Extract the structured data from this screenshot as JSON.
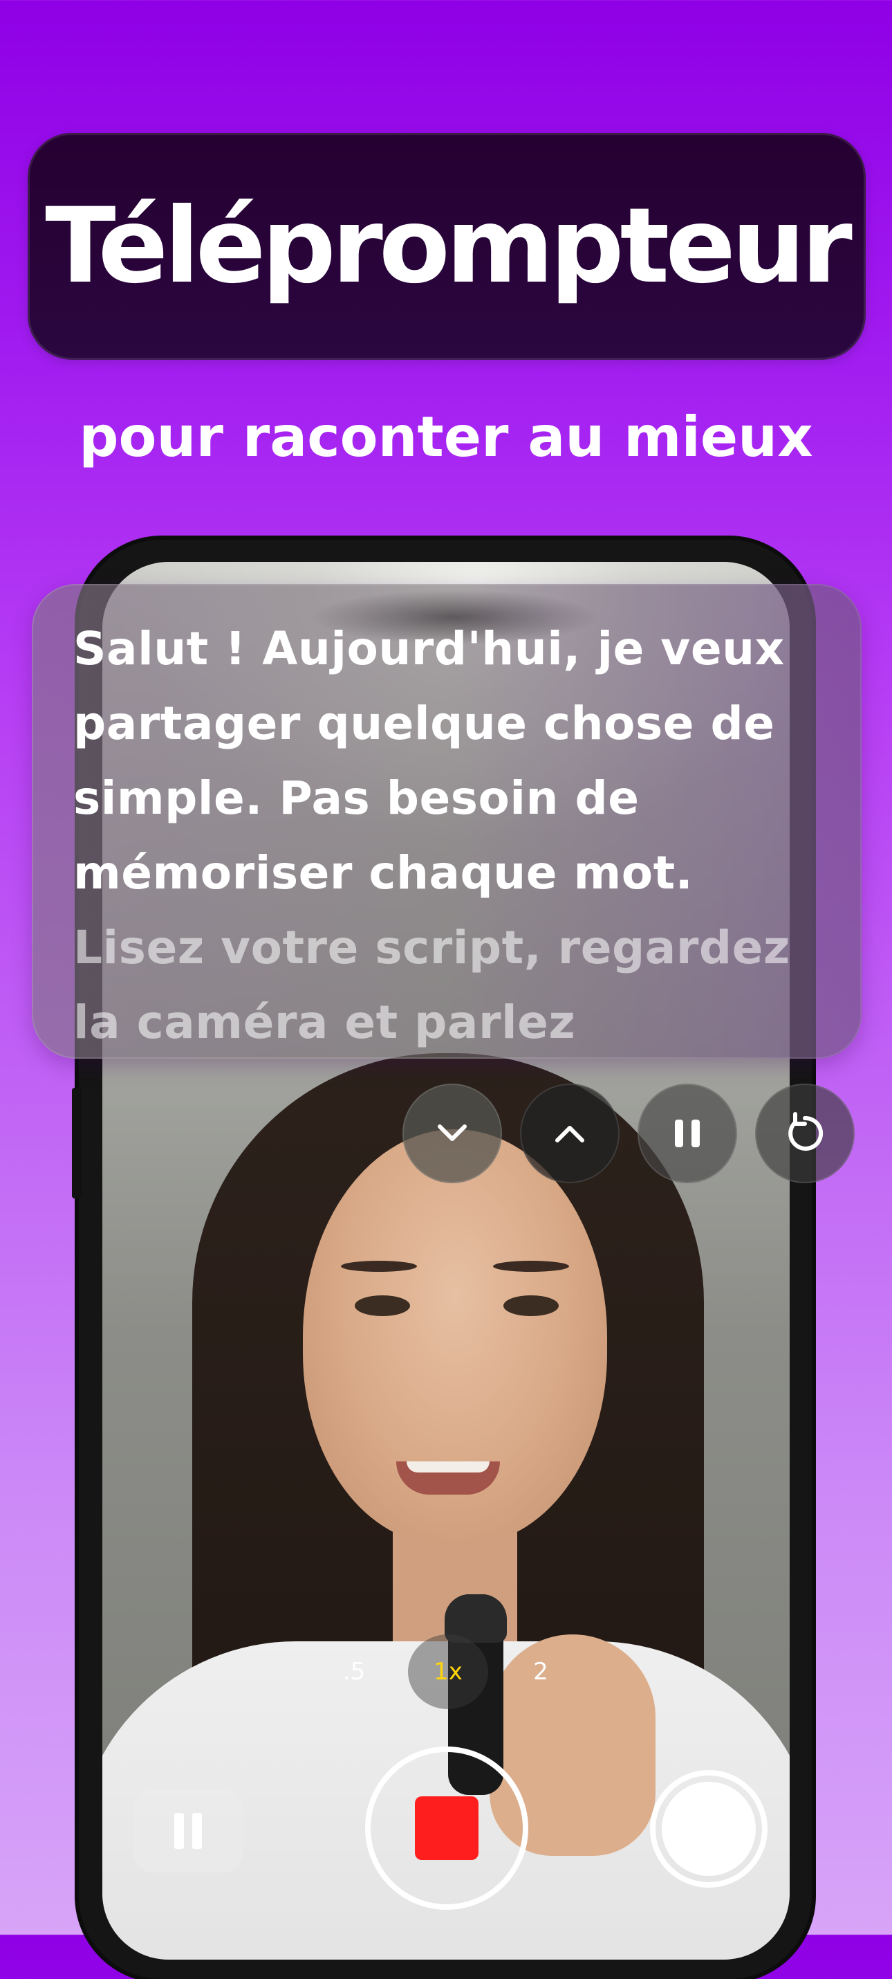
{
  "header": {
    "title": "Téléprompteur",
    "subtitle": "pour raconter au mieux"
  },
  "teleprompter": {
    "lines": [
      "Salut ! Aujourd'hui, je veux",
      "partager quelque chose de",
      "simple. Pas besoin de",
      "mémoriser chaque mot.",
      "Lisez votre script, regardez",
      "la caméra et parlez"
    ]
  },
  "controls": {
    "scroll_down_icon": "chevron-down-icon",
    "scroll_up_icon": "chevron-up-icon",
    "pause_icon": "pause-icon",
    "restart_icon": "restart-icon"
  },
  "zoom": {
    "options": [
      ".5",
      "1x",
      "2"
    ],
    "selected": "1x"
  },
  "camera": {
    "record_state": "recording",
    "stop_color": "#ff1e1e"
  },
  "colors": {
    "background_top": "#8f00e6",
    "background_bottom": "#d7a4f8",
    "title_pill": "#250031",
    "zoom_active": "#ffd60a"
  }
}
